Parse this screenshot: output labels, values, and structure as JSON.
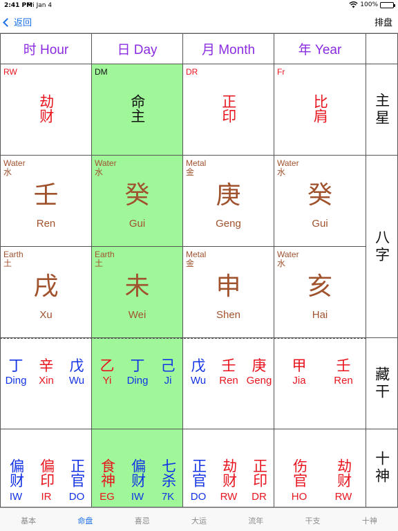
{
  "status": {
    "time": "2:41 PM",
    "date": "Fri Jan 4",
    "battery": "100%"
  },
  "nav": {
    "back_label": "返回",
    "right_label": "排盘"
  },
  "headers": [
    "时 Hour",
    "日 Day",
    "月 Month",
    "年 Year"
  ],
  "side_labels": {
    "main_star": "主星",
    "bazi": "八字",
    "hidden": "藏干",
    "ten_gods": "十神"
  },
  "main_stars": [
    {
      "code": "RW",
      "text": "劫财",
      "color": "red"
    },
    {
      "code": "DM",
      "text": "命主",
      "color": "black"
    },
    {
      "code": "DR",
      "text": "正印",
      "color": "red"
    },
    {
      "code": "Fr",
      "text": "比肩",
      "color": "red"
    }
  ],
  "stems": [
    {
      "element": "Water",
      "element_cn": "水",
      "char": "壬",
      "pinyin": "Ren"
    },
    {
      "element": "Water",
      "element_cn": "水",
      "char": "癸",
      "pinyin": "Gui"
    },
    {
      "element": "Metal",
      "element_cn": "金",
      "char": "庚",
      "pinyin": "Geng"
    },
    {
      "element": "Water",
      "element_cn": "水",
      "char": "癸",
      "pinyin": "Gui"
    }
  ],
  "branches": [
    {
      "element": "Earth",
      "element_cn": "土",
      "char": "戌",
      "pinyin": "Xu"
    },
    {
      "element": "Earth",
      "element_cn": "土",
      "char": "未",
      "pinyin": "Wei"
    },
    {
      "element": "Metal",
      "element_cn": "金",
      "char": "申",
      "pinyin": "Shen"
    },
    {
      "element": "Water",
      "element_cn": "水",
      "char": "亥",
      "pinyin": "Hai"
    }
  ],
  "hidden_stems": [
    [
      {
        "c": "丁",
        "p": "Ding",
        "color": "blue"
      },
      {
        "c": "辛",
        "p": "Xin",
        "color": "red"
      },
      {
        "c": "戊",
        "p": "Wu",
        "color": "blue"
      }
    ],
    [
      {
        "c": "乙",
        "p": "Yi",
        "color": "red"
      },
      {
        "c": "丁",
        "p": "Ding",
        "color": "blue"
      },
      {
        "c": "己",
        "p": "Ji",
        "color": "blue"
      }
    ],
    [
      {
        "c": "戊",
        "p": "Wu",
        "color": "blue"
      },
      {
        "c": "壬",
        "p": "Ren",
        "color": "red"
      },
      {
        "c": "庚",
        "p": "Geng",
        "color": "red"
      }
    ],
    [
      {
        "c": "甲",
        "p": "Jia",
        "color": "red"
      },
      {
        "c": "壬",
        "p": "Ren",
        "color": "red"
      }
    ]
  ],
  "ten_gods": [
    [
      {
        "c": "偏财",
        "p": "IW",
        "color": "blue"
      },
      {
        "c": "偏印",
        "p": "IR",
        "color": "red"
      },
      {
        "c": "正官",
        "p": "DO",
        "color": "blue"
      }
    ],
    [
      {
        "c": "食神",
        "p": "EG",
        "color": "red"
      },
      {
        "c": "偏财",
        "p": "IW",
        "color": "blue"
      },
      {
        "c": "七杀",
        "p": "7K",
        "color": "blue"
      }
    ],
    [
      {
        "c": "正官",
        "p": "DO",
        "color": "blue"
      },
      {
        "c": "劫财",
        "p": "RW",
        "color": "red"
      },
      {
        "c": "正印",
        "p": "DR",
        "color": "red"
      }
    ],
    [
      {
        "c": "伤官",
        "p": "HO",
        "color": "red"
      },
      {
        "c": "劫财",
        "p": "RW",
        "color": "red"
      }
    ]
  ],
  "tabs": [
    "基本",
    "命盘",
    "喜忌",
    "大运",
    "流年",
    "干支",
    "十神"
  ],
  "active_tab": "命盘"
}
